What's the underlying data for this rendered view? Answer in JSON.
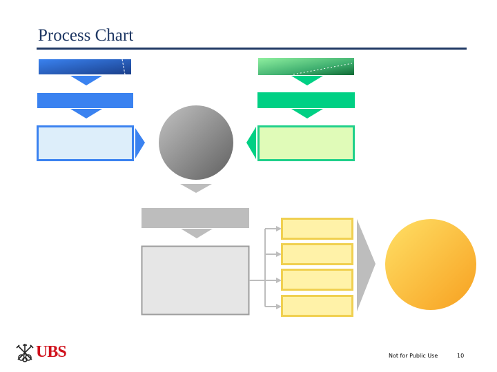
{
  "header": {
    "title": "Process Chart"
  },
  "footer": {
    "note": "Not for Public Use",
    "page_number": "10",
    "logo_text": "UBS"
  },
  "colors": {
    "title_navy": "#1f3864",
    "blue_accent": "#3a82f0",
    "blue_fill_light": "#ddeefa",
    "green_accent": "#00d084",
    "green_fill_light": "#e0fbb8",
    "gray_accent": "#bdbdbd",
    "gray_fill_light": "#e6e6e6",
    "gray_border": "#9e9e9e",
    "yellow_border": "#f0d050",
    "yellow_fill_light": "#fff2a8",
    "orange_gradient_start": "#ffdd66",
    "orange_gradient_end": "#f7a41c",
    "logo_red": "#d0101b"
  },
  "diagram": {
    "left_column": {
      "header": "",
      "step": "",
      "box": ""
    },
    "right_column": {
      "header": "",
      "step": "",
      "box": ""
    },
    "center_circle": {
      "label": ""
    },
    "center_bar": {
      "label": ""
    },
    "center_box": {
      "label": ""
    },
    "output_boxes": [
      {
        "label": ""
      },
      {
        "label": ""
      },
      {
        "label": ""
      },
      {
        "label": ""
      }
    ],
    "result_circle": {
      "label": ""
    }
  }
}
